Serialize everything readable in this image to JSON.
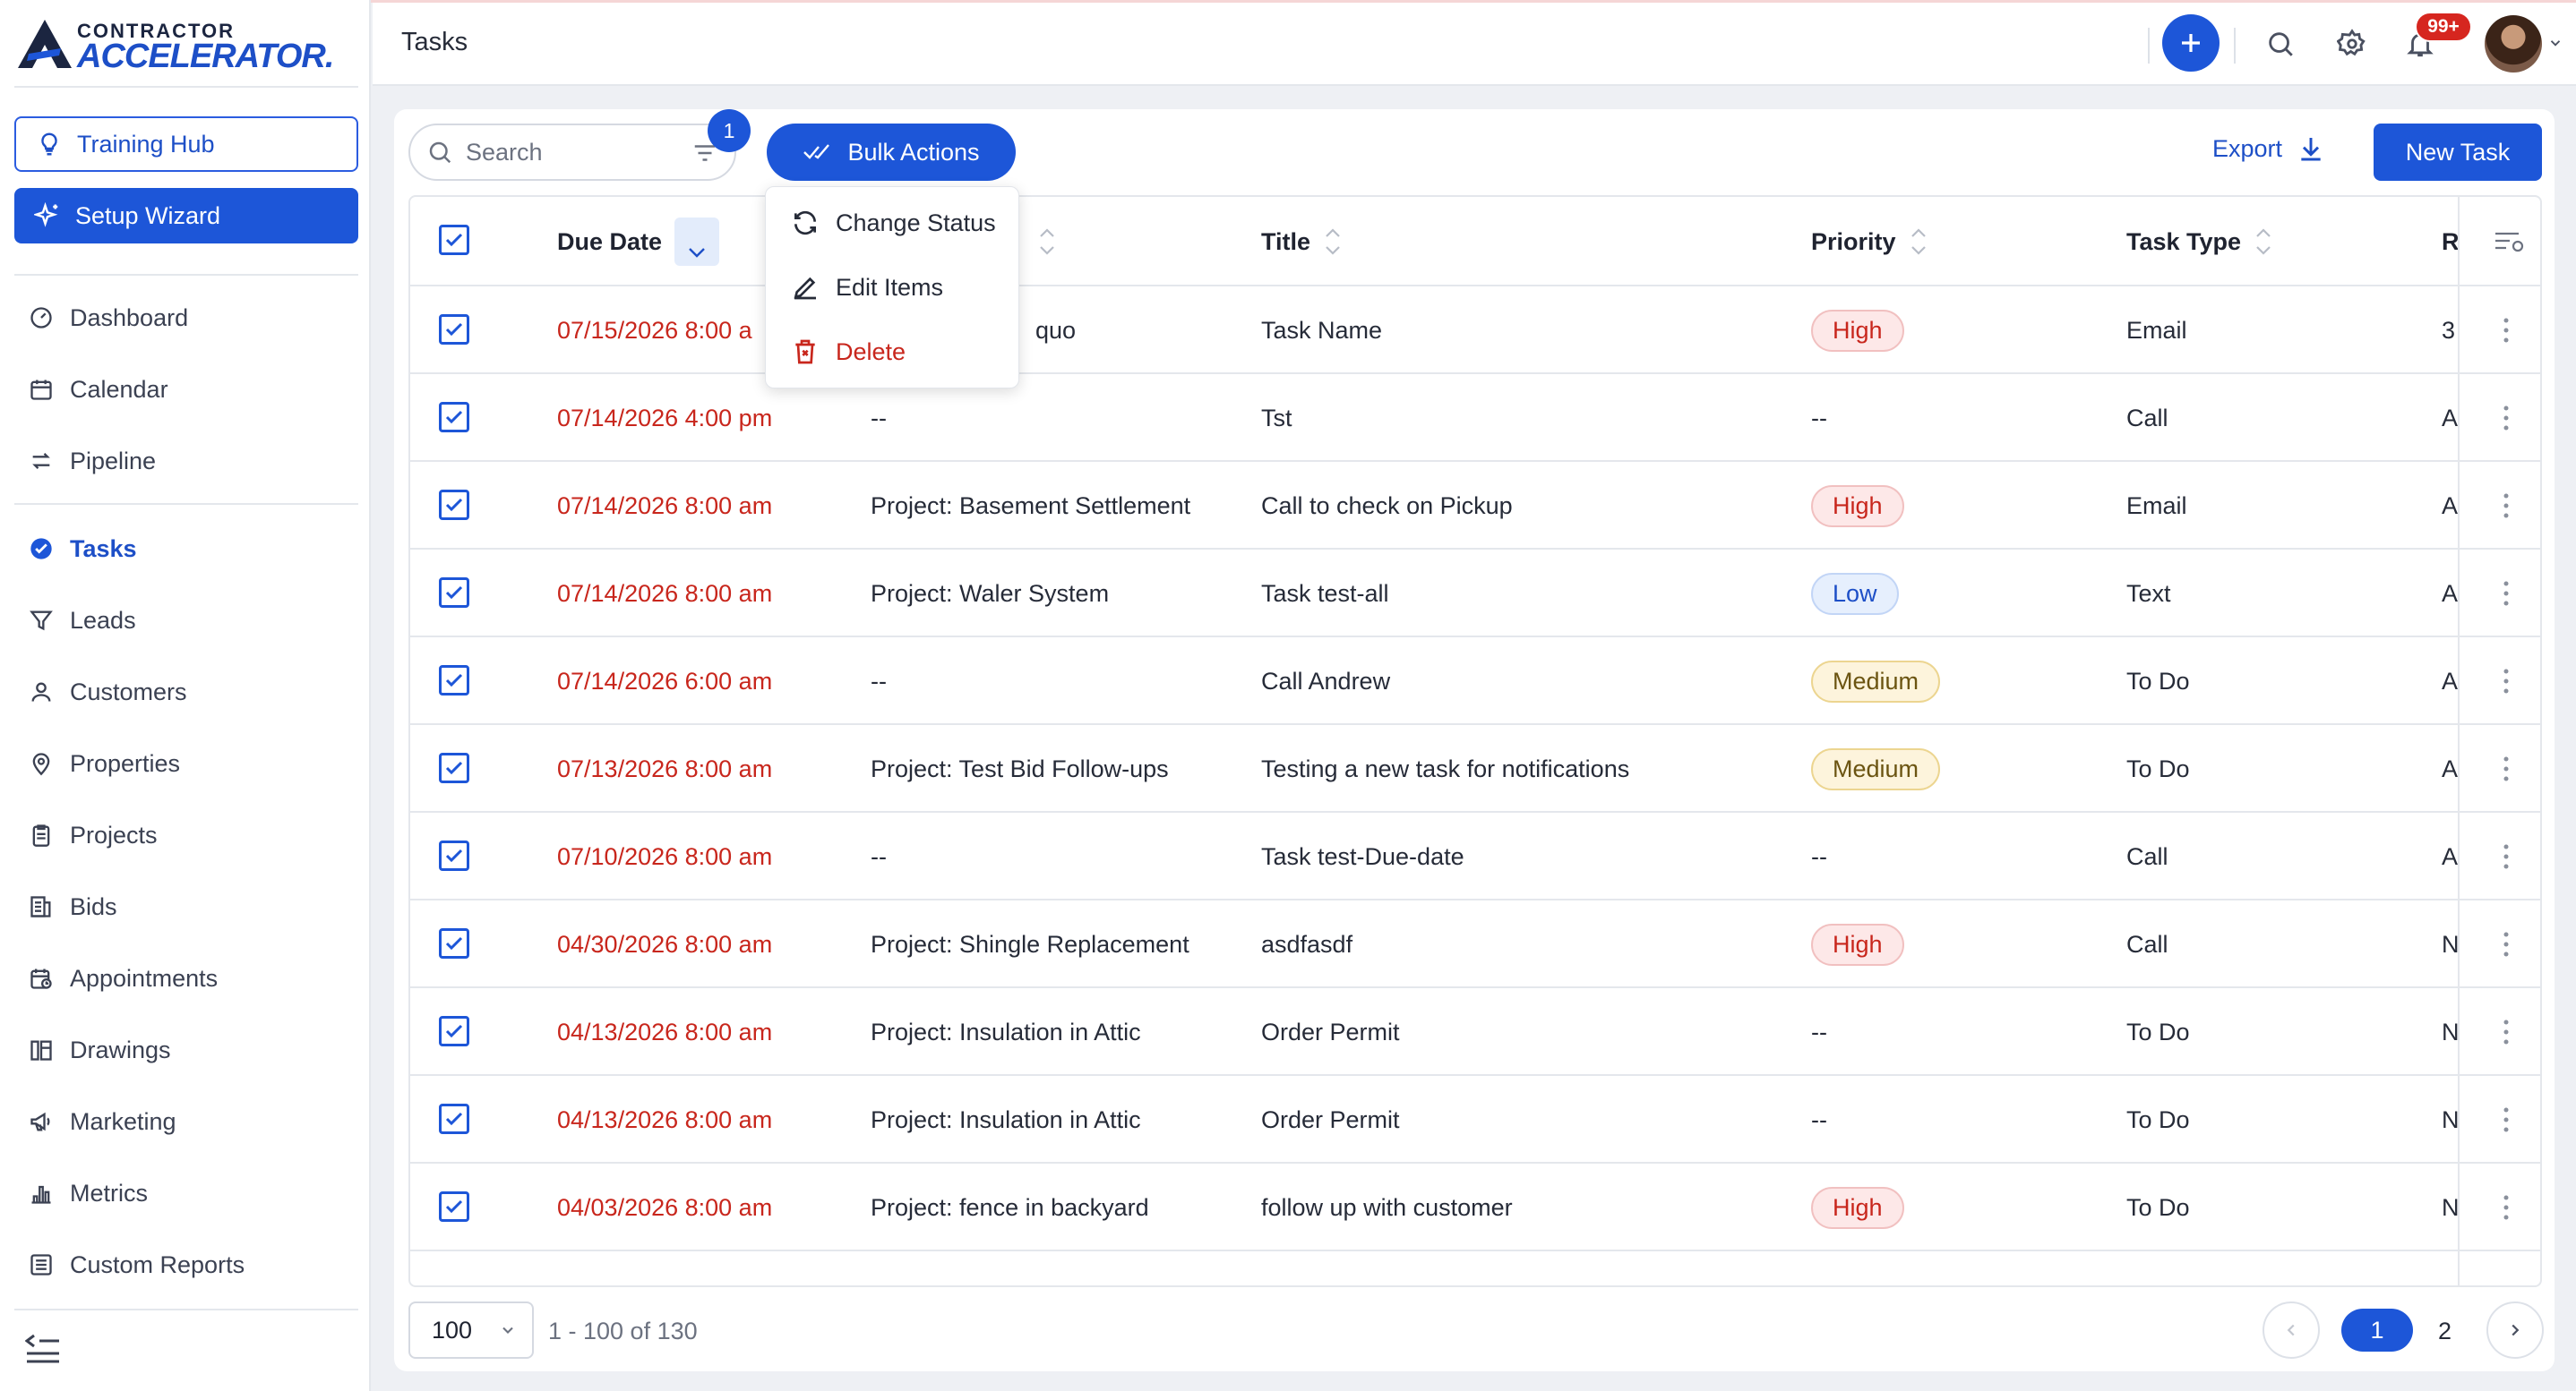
{
  "app": {
    "logo_top": "CONTRACTOR",
    "logo_bottom": "ACCELERATOR."
  },
  "sidebar": {
    "training_hub": "Training Hub",
    "setup_wizard": "Setup Wizard",
    "items": [
      {
        "label": "Dashboard",
        "icon": "dashboard-icon"
      },
      {
        "label": "Calendar",
        "icon": "calendar-icon"
      },
      {
        "label": "Pipeline",
        "icon": "pipeline-icon"
      },
      {
        "label": "Tasks",
        "icon": "tasks-icon",
        "active": true
      },
      {
        "label": "Leads",
        "icon": "filter-icon"
      },
      {
        "label": "Customers",
        "icon": "person-icon"
      },
      {
        "label": "Properties",
        "icon": "location-icon"
      },
      {
        "label": "Projects",
        "icon": "clipboard-icon"
      },
      {
        "label": "Bids",
        "icon": "bids-icon"
      },
      {
        "label": "Appointments",
        "icon": "appointment-icon"
      },
      {
        "label": "Drawings",
        "icon": "drawings-icon"
      },
      {
        "label": "Marketing",
        "icon": "megaphone-icon"
      },
      {
        "label": "Metrics",
        "icon": "bar-chart-icon"
      },
      {
        "label": "Custom Reports",
        "icon": "report-icon"
      }
    ]
  },
  "header": {
    "title": "Tasks",
    "notification_count": "99+"
  },
  "toolbar": {
    "search_placeholder": "Search",
    "filter_count": "1",
    "bulk_actions": "Bulk Actions",
    "export": "Export",
    "new_task": "New Task"
  },
  "bulk_menu": {
    "change_status": "Change Status",
    "edit_items": "Edit Items",
    "delete": "Delete"
  },
  "table": {
    "columns": {
      "due_date": "Due Date",
      "title": "Title",
      "priority": "Priority",
      "task_type": "Task Type",
      "r": "R"
    },
    "rows": [
      {
        "due": "07/15/2026 8:00 a",
        "related": "quo",
        "title": "Task Name",
        "priority": "High",
        "type": "Email",
        "r": "3"
      },
      {
        "due": "07/14/2026 4:00 pm",
        "related": "--",
        "title": "Tst",
        "priority": "--",
        "type": "Call",
        "r": "A"
      },
      {
        "due": "07/14/2026 8:00 am",
        "related": "Project: Basement Settlement",
        "title": "Call to check on Pickup",
        "priority": "High",
        "type": "Email",
        "r": "A"
      },
      {
        "due": "07/14/2026 8:00 am",
        "related": "Project: Waler System",
        "title": "Task test-all",
        "priority": "Low",
        "type": "Text",
        "r": "A"
      },
      {
        "due": "07/14/2026 6:00 am",
        "related": "--",
        "title": "Call Andrew",
        "priority": "Medium",
        "type": "To Do",
        "r": "A"
      },
      {
        "due": "07/13/2026 8:00 am",
        "related": "Project: Test Bid Follow-ups",
        "title": "Testing a new task for notifications",
        "priority": "Medium",
        "type": "To Do",
        "r": "A"
      },
      {
        "due": "07/10/2026 8:00 am",
        "related": "--",
        "title": "Task test-Due-date",
        "priority": "--",
        "type": "Call",
        "r": "A"
      },
      {
        "due": "04/30/2026 8:00 am",
        "related": "Project: Shingle Replacement",
        "title": "asdfasdf",
        "priority": "High",
        "type": "Call",
        "r": "N"
      },
      {
        "due": "04/13/2026 8:00 am",
        "related": "Project: Insulation in Attic",
        "title": "Order Permit",
        "priority": "--",
        "type": "To Do",
        "r": "N"
      },
      {
        "due": "04/13/2026 8:00 am",
        "related": "Project: Insulation in Attic",
        "title": "Order Permit",
        "priority": "--",
        "type": "To Do",
        "r": "N"
      },
      {
        "due": "04/03/2026 8:00 am",
        "related": "Project: fence in backyard",
        "title": "follow up with customer",
        "priority": "High",
        "type": "To Do",
        "r": "N"
      }
    ]
  },
  "pagination": {
    "per_page": "100",
    "range": "1 - 100 of 130",
    "current_page": "1",
    "next_page": "2"
  },
  "colors": {
    "primary": "#1d56d8",
    "danger": "#c8261c",
    "medium": "#ecd590"
  }
}
